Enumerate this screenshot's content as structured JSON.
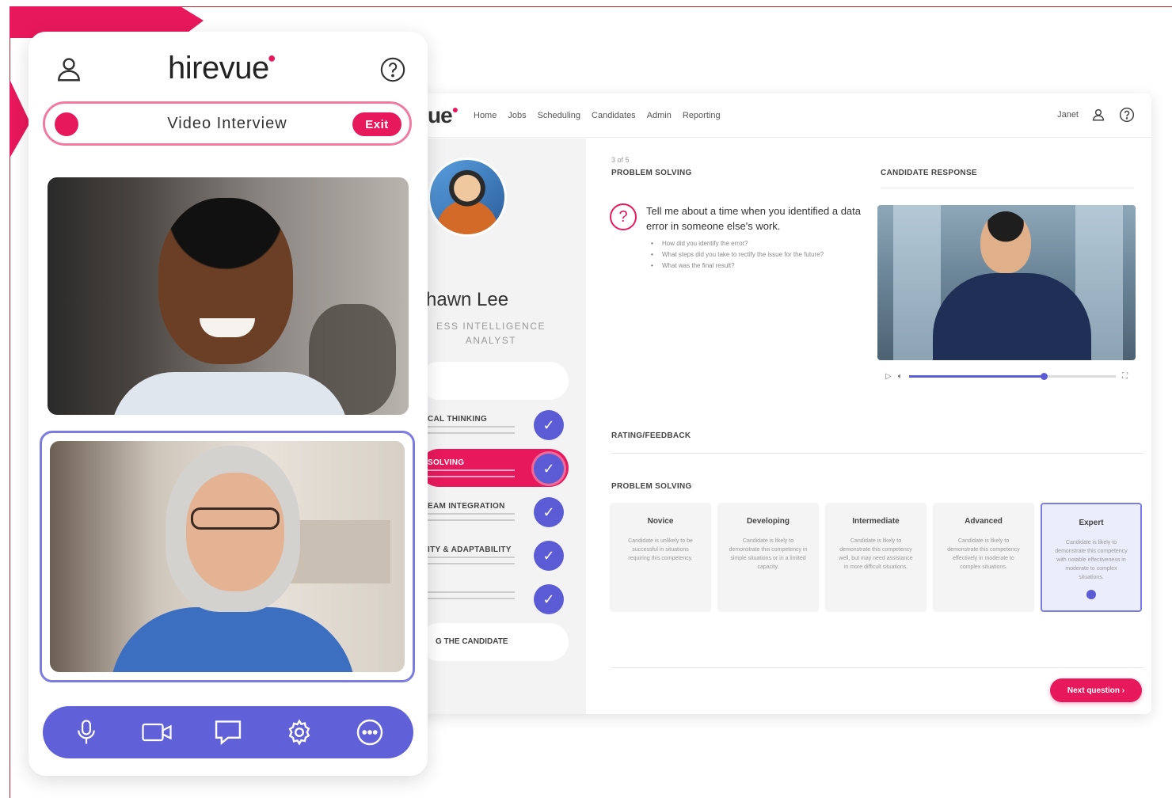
{
  "colors": {
    "brand_pink": "#e8185c",
    "accent_purple": "#5b5bd6",
    "toolbar_purple": "#6060d8"
  },
  "mobile": {
    "logo": "hirevue",
    "header_icons": [
      "user-icon",
      "help-icon"
    ],
    "interview_bar": {
      "title": "Video Interview",
      "exit_label": "Exit"
    },
    "toolbar_icons": [
      "microphone-icon",
      "camera-icon",
      "chat-icon",
      "settings-icon",
      "more-icon"
    ]
  },
  "desktop": {
    "logo_fragment": "ue",
    "nav": [
      "Home",
      "Jobs",
      "Scheduling",
      "Candidates",
      "Admin",
      "Reporting"
    ],
    "user_name": "Janet",
    "candidate": {
      "name": "hawn Lee",
      "role": "ESS INTELLIGENCE ANALYST"
    },
    "competencies": [
      {
        "title": "CAL THINKING",
        "checked": true,
        "active": false
      },
      {
        "title": "SOLVING",
        "checked": true,
        "active": true
      },
      {
        "title": "EAM INTEGRATION",
        "checked": true,
        "active": false
      },
      {
        "title": "ITY & ADAPTABILITY",
        "checked": true,
        "active": false
      },
      {
        "title": "",
        "checked": true,
        "active": false
      }
    ],
    "last_item": "G THE CANDIDATE",
    "question": {
      "count": "3 of 5",
      "section": "PROBLEM SOLVING",
      "text": "Tell me about a time when you identified a data error in someone else's work.",
      "bullets": [
        "How did you identify the error?",
        "What steps did you take to rectify the issue for the future?",
        "What was the final result?"
      ]
    },
    "response_label": "CANDIDATE RESPONSE",
    "video_progress": 0.65,
    "rating_label": "RATING/FEEDBACK",
    "rating_section": "PROBLEM SOLVING",
    "ratings": [
      {
        "title": "Novice",
        "desc": "Candidate is unlikely to be successful in situations requiring this competency.",
        "selected": false
      },
      {
        "title": "Developing",
        "desc": "Candidate is likely to demonstrate this competency in simple situations or in a limited capacity.",
        "selected": false
      },
      {
        "title": "Intermediate",
        "desc": "Candidate is likely to demonstrate this competency well, but may need assistance in more difficult situations.",
        "selected": false
      },
      {
        "title": "Advanced",
        "desc": "Candidate is likely to demonstrate this competency effectively in moderate to complex situations.",
        "selected": false
      },
      {
        "title": "Expert",
        "desc": "Candidate is likely to demonstrate this competency with notable effectiveness in moderate to complex situations.",
        "selected": true
      }
    ],
    "next_button": "Next question"
  }
}
